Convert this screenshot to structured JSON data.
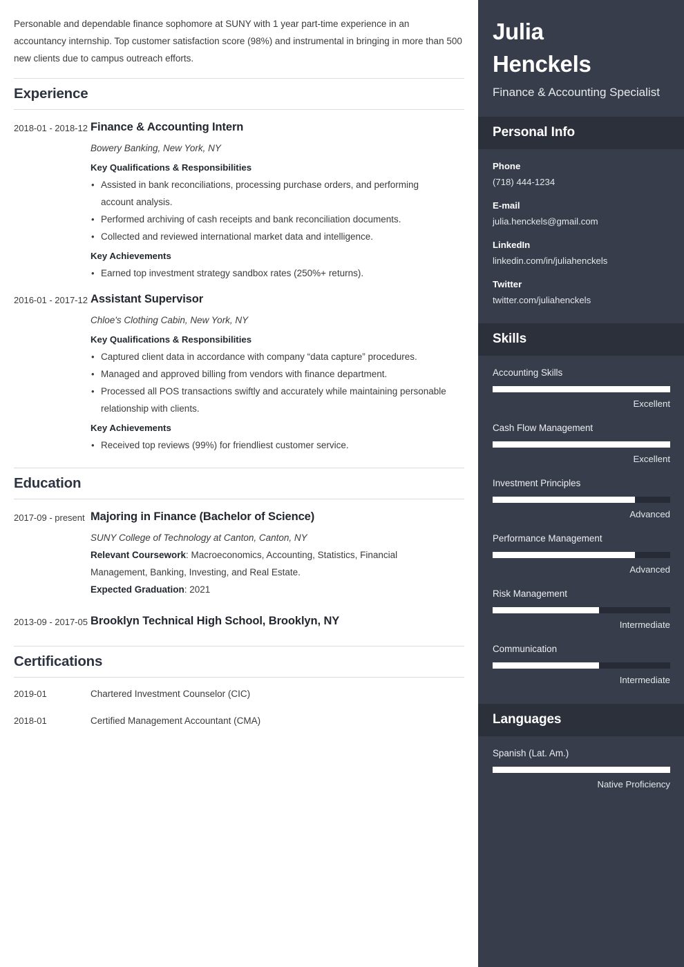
{
  "main": {
    "summary": "Personable and dependable finance sophomore at SUNY with 1 year part-time experience in an accountancy internship. Top customer satisfaction score (98%) and instrumental in bringing in more than 500 new clients due to campus outreach efforts.",
    "sections": {
      "experience_title": "Experience",
      "education_title": "Education",
      "certifications_title": "Certifications"
    },
    "experience": [
      {
        "date": "2018-01 - 2018-12",
        "title": "Finance & Accounting Intern",
        "org": "Bowery Banking, New York, NY",
        "qual_head": "Key Qualifications & Responsibilities",
        "quals": [
          "Assisted in bank reconciliations, processing purchase orders, and performing account analysis.",
          "Performed archiving of cash receipts and bank reconciliation documents.",
          "Collected and reviewed international market data and intelligence."
        ],
        "ach_head": "Key Achievements",
        "achievements": [
          "Earned top investment strategy sandbox rates (250%+ returns)."
        ]
      },
      {
        "date": "2016-01 - 2017-12",
        "title": "Assistant Supervisor",
        "org": "Chloe's Clothing Cabin, New York, NY",
        "qual_head": "Key Qualifications & Responsibilities",
        "quals": [
          "Captured client data in accordance with company “data capture” procedures.",
          "Managed and approved billing from vendors with finance department.",
          "Processed all POS transactions swiftly and accurately while maintaining personable relationship with clients."
        ],
        "ach_head": "Key Achievements",
        "achievements": [
          "Received top reviews (99%) for friendliest customer service."
        ]
      }
    ],
    "education": [
      {
        "date": "2017-09 - present",
        "title": "Majoring in Finance (Bachelor of Science)",
        "org": "SUNY College of Technology at Canton, Canton, NY",
        "coursework_label": "Relevant Coursework",
        "coursework_value": ": Macroeconomics, Accounting, Statistics, Financial Management, Banking, Investing, and Real Estate.",
        "graduation_label": "Expected Graduation",
        "graduation_value": ": 2021"
      },
      {
        "date": "2013-09 - 2017-05",
        "title": "Brooklyn Technical High School, Brooklyn, NY",
        "org": "",
        "coursework_label": "",
        "coursework_value": "",
        "graduation_label": "",
        "graduation_value": ""
      }
    ],
    "certifications": [
      {
        "date": "2019-01",
        "name": "Chartered Investment Counselor (CIC)"
      },
      {
        "date": "2018-01",
        "name": "Certified Management Accountant (CMA)"
      }
    ]
  },
  "sidebar": {
    "name_line1": "Julia",
    "name_line2": "Henckels",
    "role": "Finance & Accounting Specialist",
    "personal_info_title": "Personal Info",
    "personal_info": [
      {
        "label": "Phone",
        "value": "(718) 444-1234"
      },
      {
        "label": "E-mail",
        "value": "julia.henckels@gmail.com"
      },
      {
        "label": "LinkedIn",
        "value": "linkedin.com/in/juliahenckels"
      },
      {
        "label": "Twitter",
        "value": "twitter.com/juliahenckels"
      }
    ],
    "skills_title": "Skills",
    "skills": [
      {
        "name": "Accounting Skills",
        "level": "Excellent",
        "percent": 100
      },
      {
        "name": "Cash Flow Management",
        "level": "Excellent",
        "percent": 100
      },
      {
        "name": "Investment Principles",
        "level": "Advanced",
        "percent": 80
      },
      {
        "name": "Performance Management",
        "level": "Advanced",
        "percent": 80
      },
      {
        "name": "Risk Management",
        "level": "Intermediate",
        "percent": 60
      },
      {
        "name": "Communication",
        "level": "Intermediate",
        "percent": 60
      }
    ],
    "languages_title": "Languages",
    "languages": [
      {
        "name": "Spanish (Lat. Am.)",
        "level": "Native Proficiency",
        "percent": 100
      }
    ]
  },
  "colors": {
    "sidebar_bg": "#373d4a",
    "sidebar_header_bg": "#2b303b",
    "bar_track": "#262b35",
    "bar_fill": "#ffffff",
    "heading": "#2d3340",
    "body_text": "#3b3b3b",
    "rule": "#dcdcdc"
  }
}
